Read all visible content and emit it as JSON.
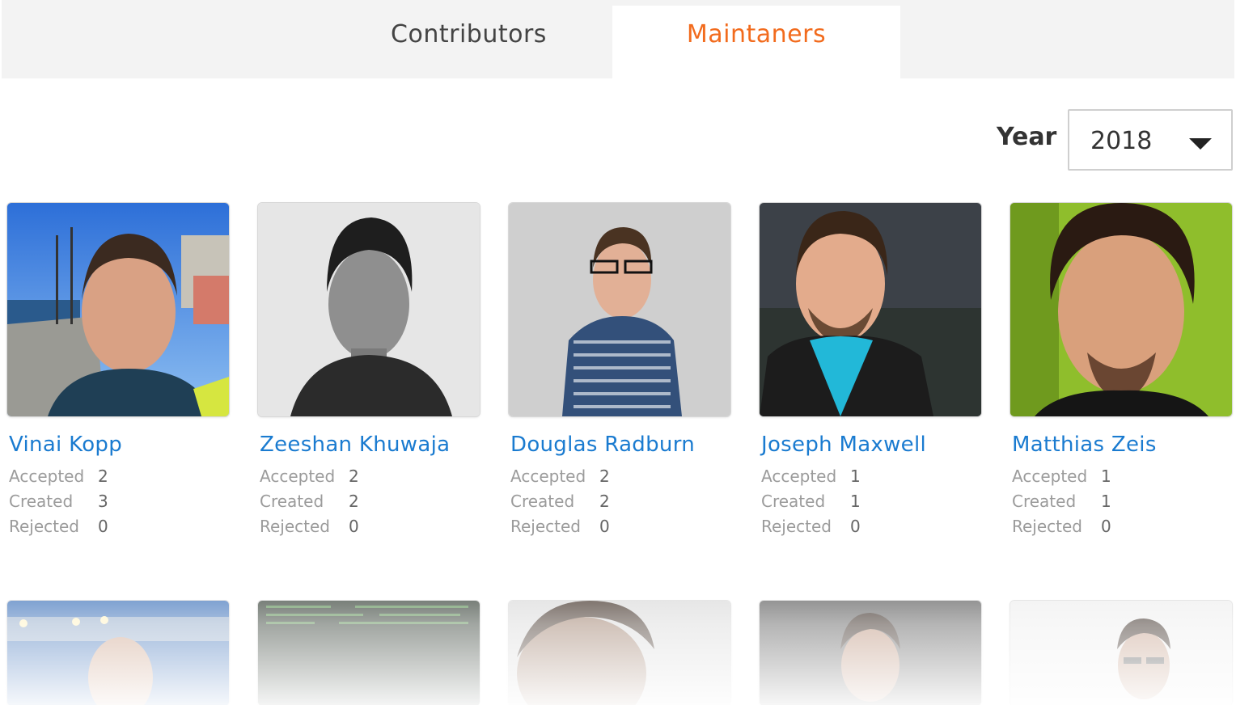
{
  "tabs": [
    {
      "label": "Contributors",
      "active": false
    },
    {
      "label": "Maintaners",
      "active": true
    }
  ],
  "filter": {
    "label": "Year",
    "selected": "2018"
  },
  "colors": {
    "accent": "#f26b1d",
    "link": "#1a7bd0",
    "tabbar_bg": "#f3f3f3",
    "muted_text": "#9b9b9b"
  },
  "stat_labels": {
    "accepted": "Accepted",
    "created": "Created",
    "rejected": "Rejected"
  },
  "maintainers": [
    {
      "name": "Vinai Kopp",
      "accepted": "2",
      "created": "3",
      "rejected": "0"
    },
    {
      "name": "Zeeshan Khuwaja",
      "accepted": "2",
      "created": "2",
      "rejected": "0"
    },
    {
      "name": "Douglas Radburn",
      "accepted": "2",
      "created": "2",
      "rejected": "0"
    },
    {
      "name": "Joseph Maxwell",
      "accepted": "1",
      "created": "1",
      "rejected": "0"
    },
    {
      "name": "Matthias Zeis",
      "accepted": "1",
      "created": "1",
      "rejected": "0"
    }
  ]
}
